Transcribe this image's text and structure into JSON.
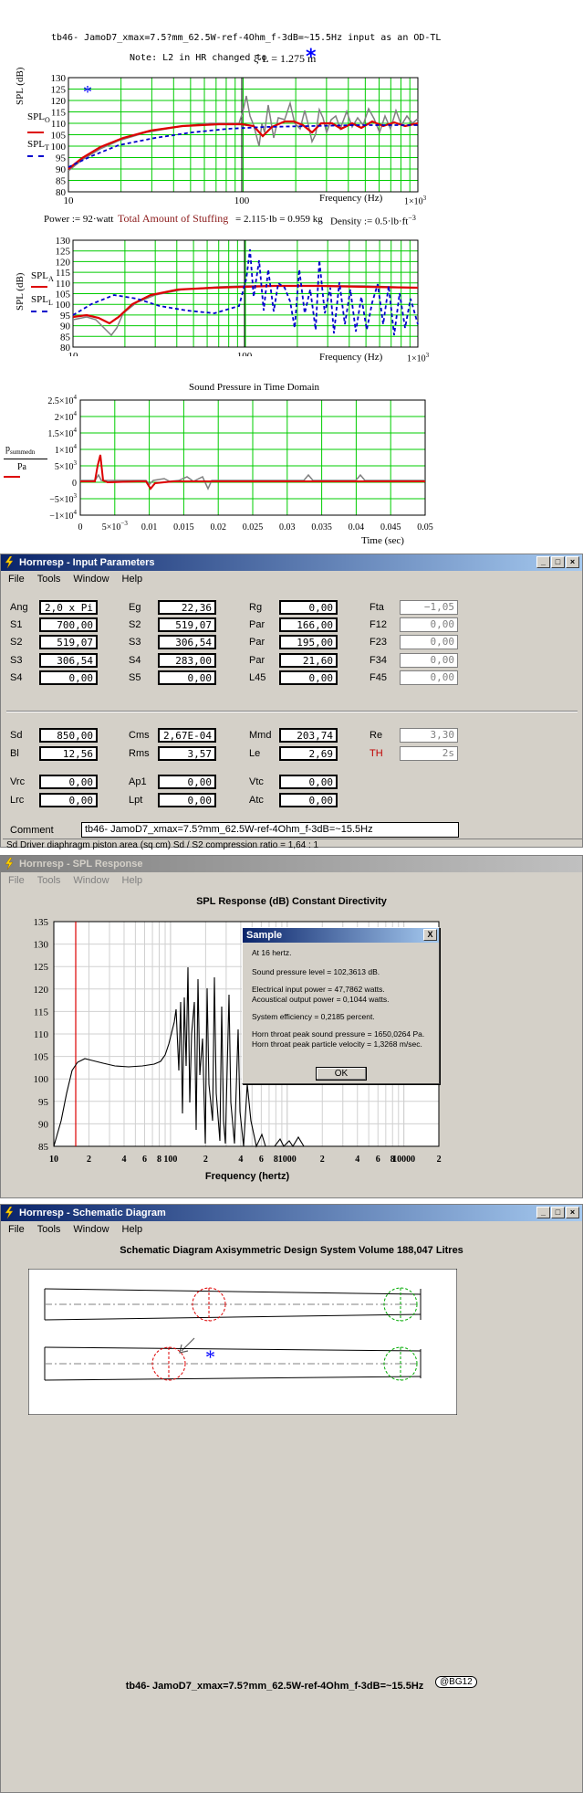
{
  "plot1": {
    "title": "tb46- JamoD7_xmax=7.5?mm_62.5W-ref-4Ohm_f-3dB=~15.5Hz input as an OD-TL",
    "note_prefix": "Note: L2 in HR  changed to",
    "note_expr": "ξ·L = 1.275 m",
    "asterisk": "*",
    "ylabel": "SPL (dB)",
    "legend1": "SPL",
    "legend1_sub": "O",
    "legend1_sub2": "1",
    "legend2": "SPL",
    "legend2_sub": "T",
    "xlabel": "Frequency (Hz)",
    "yticks": [
      "130",
      "125",
      "120",
      "115",
      "110",
      "105",
      "100",
      "95",
      "90",
      "85",
      "80"
    ],
    "xticks": [
      "10",
      "100"
    ],
    "x_last": "1×10",
    "x_last_exp": "3"
  },
  "params_line": {
    "power": "Power := 92·watt",
    "stuffing_label": "Total Amount of Stuffing",
    "stuffing_value": "= 2.115·lb = 0.959 kg",
    "density": "Density := 0.5·lb·ft",
    "density_exp": "−3"
  },
  "plot2": {
    "ylabel": "SPL (dB)",
    "legend1": "SPL",
    "legend1_sub": "A",
    "legend2": "SPL",
    "legend2_sub": "L",
    "xlabel": "Frequency (Hz)",
    "yticks": [
      "130",
      "125",
      "120",
      "115",
      "110",
      "105",
      "100",
      "95",
      "90",
      "85",
      "80"
    ],
    "xticks": [
      "10",
      "100"
    ],
    "x_last": "1×10",
    "x_last_exp": "3"
  },
  "plot3": {
    "title": "Sound Pressure in Time Domain",
    "ylabel_num": "p",
    "ylabel_num_sub": "summed",
    "ylabel_num_sub2": "n",
    "ylabel_den": "Pa",
    "xlabel": "Time (sec)",
    "yticks": [
      "2.5×10",
      "2×10",
      "1.5×10",
      "1×10",
      "5×10",
      "0",
      "−5×10",
      "−1×10"
    ],
    "yexps": [
      "4",
      "4",
      "4",
      "4",
      "3",
      "",
      "3",
      "4"
    ],
    "xticks": [
      "0",
      "5×10",
      "0.01",
      "0.015",
      "0.02",
      "0.025",
      "0.03",
      "0.035",
      "0.04",
      "0.045",
      "0.05"
    ],
    "x2_exp": "−3"
  },
  "input_window": {
    "title": "Hornresp - Input Parameters",
    "menu": [
      "File",
      "Tools",
      "Window",
      "Help"
    ],
    "rows1": [
      [
        {
          "l": "Ang",
          "v": "2,0 x Pi"
        },
        {
          "l": "Eg",
          "v": "22,36"
        },
        {
          "l": "Rg",
          "v": "0,00"
        },
        {
          "l": "Fta",
          "v": "−1,05"
        }
      ],
      [
        {
          "l": "S1",
          "v": "700,00"
        },
        {
          "l": "S2",
          "v": "519,07"
        },
        {
          "l": "Par",
          "v": "166,00"
        },
        {
          "l": "F12",
          "v": "0,00"
        }
      ],
      [
        {
          "l": "S2",
          "v": "519,07"
        },
        {
          "l": "S3",
          "v": "306,54"
        },
        {
          "l": "Par",
          "v": "195,00"
        },
        {
          "l": "F23",
          "v": "0,00"
        }
      ],
      [
        {
          "l": "S3",
          "v": "306,54"
        },
        {
          "l": "S4",
          "v": "283,00"
        },
        {
          "l": "Par",
          "v": "21,60"
        },
        {
          "l": "F34",
          "v": "0,00"
        }
      ],
      [
        {
          "l": "S4",
          "v": "0,00"
        },
        {
          "l": "S5",
          "v": "0,00"
        },
        {
          "l": "L45",
          "v": "0,00"
        },
        {
          "l": "F45",
          "v": "0,00"
        }
      ]
    ],
    "rows2": [
      [
        {
          "l": "Sd",
          "v": "850,00"
        },
        {
          "l": "Cms",
          "v": "2,67E-04"
        },
        {
          "l": "Mmd",
          "v": "203,74"
        },
        {
          "l": "Re",
          "v": "3,30"
        }
      ],
      [
        {
          "l": "Bl",
          "v": "12,56"
        },
        {
          "l": "Rms",
          "v": "3,57"
        },
        {
          "l": "Le",
          "v": "2,69"
        },
        {
          "l": "TH",
          "v": "2s"
        }
      ],
      [
        {
          "l": "Vrc",
          "v": "0,00"
        },
        {
          "l": "Ap1",
          "v": "0,00"
        },
        {
          "l": "Vtc",
          "v": "0,00"
        }
      ],
      [
        {
          "l": "Lrc",
          "v": "0,00"
        },
        {
          "l": "Lpt",
          "v": "0,00"
        },
        {
          "l": "Atc",
          "v": "0,00"
        }
      ]
    ],
    "comment_label": "Comment",
    "comment_value": "tb46- JamoD7_xmax=7.5?mm_62.5W-ref-4Ohm_f-3dB=~15.5Hz",
    "status": "Sd   Driver diaphragm piston area  (sq cm)    Sd / S2 compression ratio = 1,64 : 1",
    "accent_red": "#c00000"
  },
  "spl_window": {
    "title": "Hornresp - SPL Response",
    "menu": [
      "File",
      "Tools",
      "Window",
      "Help"
    ],
    "heading": "SPL Response (dB)   Constant Directivity",
    "yticks": [
      "135",
      "130",
      "125",
      "120",
      "115",
      "110",
      "105",
      "100",
      "95",
      "90",
      "85"
    ],
    "xticks": [
      "10",
      "2",
      "4",
      "6",
      "8",
      "100",
      "2",
      "4",
      "6",
      "8",
      "1000",
      "2",
      "4",
      "6",
      "8",
      "10000",
      "2"
    ],
    "xlabel": "Frequency (hertz)",
    "dialog": {
      "title": "Sample",
      "close": "X",
      "lines": [
        "At 16 hertz.",
        "Sound pressure level = 102,3613 dB.",
        "Electrical input power = 47,7862 watts.",
        "Acoustical output power = 0,1044 watts.",
        "System efficiency = 0,2185 percent.",
        "Horn throat peak sound pressure = 1650,0264 Pa.",
        "Horn throat peak particle velocity = 1,3268 m/sec."
      ],
      "ok": "OK"
    }
  },
  "schematic_window": {
    "title": "Hornresp - Schematic Diagram",
    "menu": [
      "File",
      "Tools",
      "Window",
      "Help"
    ],
    "heading": "Schematic Diagram   Axisymmetric Design   System Volume 188,047 Litres",
    "asterisk": "*",
    "footer": "tb46- JamoD7_xmax=7.5?mm_62.5W-ref-4Ohm_f-3dB=~15.5Hz",
    "badge": "@BG12"
  }
}
